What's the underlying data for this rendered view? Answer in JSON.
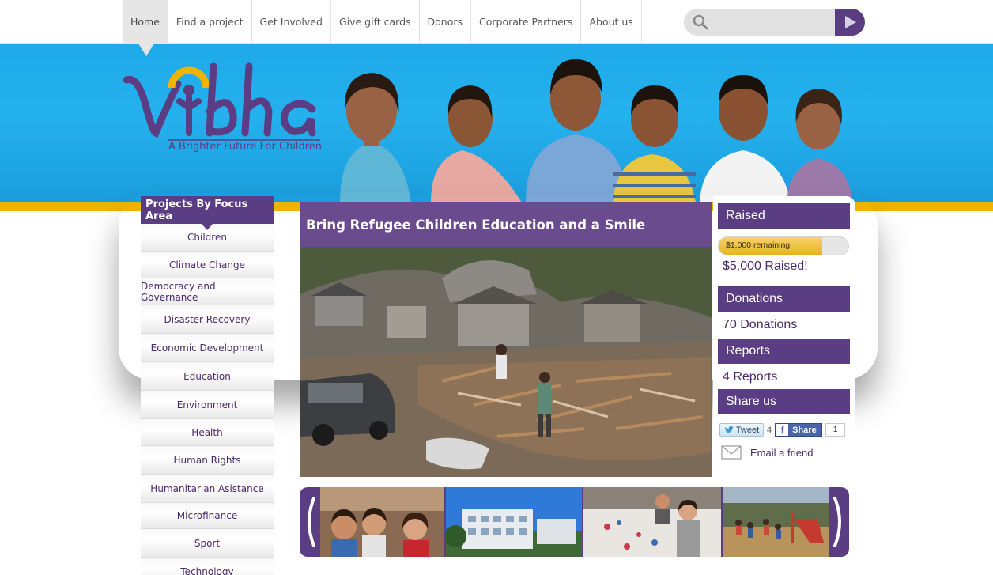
{
  "nav": {
    "items": [
      "Home",
      "Find a project",
      "Get Involved",
      "Give gift cards",
      "Donors",
      "Corporate Partners",
      "About us"
    ],
    "active": "Home"
  },
  "search": {
    "placeholder": "",
    "icon": "search-icon",
    "submit_icon": "play-arrow-icon"
  },
  "brand": {
    "name": "Vibha",
    "tagline": "A Brighter Future For Children",
    "colors": {
      "purple": "#5a3d82",
      "yellow": "#f0b400",
      "sky": "#1ea9e8"
    }
  },
  "sidebar": {
    "title": "Projects By Focus Area",
    "items": [
      "Children",
      "Climate Change",
      "Democracy and Governance",
      "Disaster Recovery",
      "Economic Development",
      "Education",
      "Environment",
      "Health",
      "Human Rights",
      "Humanitarian Asistance",
      "Microfinance",
      "Sport",
      "Technology"
    ]
  },
  "slide": {
    "title": "Bring Refugee Children Education and a Smile"
  },
  "stats": {
    "raised_title": "Raised",
    "remaining_label": "$1,000 remaining",
    "progress_fraction": 0.8,
    "raised_value": "$5,000 Raised!",
    "donations_title": "Donations",
    "donations_value": "70 Donations",
    "reports_title": "Reports",
    "reports_value": "4 Reports",
    "share_title": "Share us",
    "tweet_label": "Tweet",
    "tweet_count": "4",
    "fb_label": "Share",
    "fb_count": "1",
    "email_label": "Email a friend"
  }
}
